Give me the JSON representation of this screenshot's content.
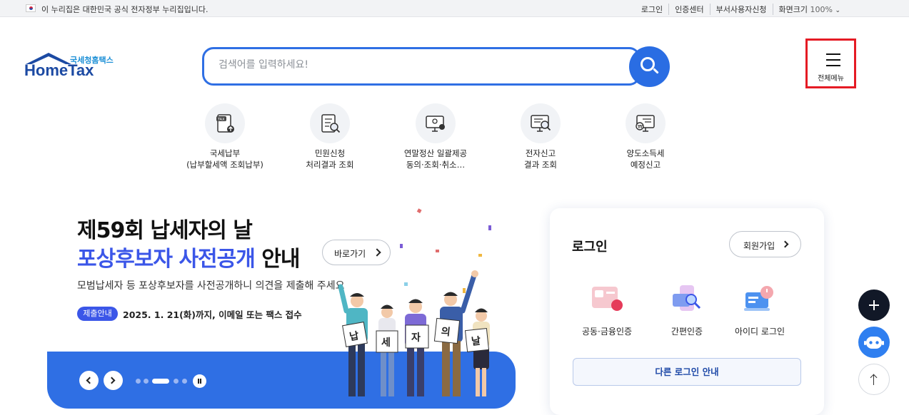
{
  "gov_bar": {
    "notice": "이 누리집은 대한민국 공식 전자정부 누리집입니다.",
    "links": [
      "로그인",
      "인증센터",
      "부서사용자신청"
    ],
    "zoom_label": "화면크기",
    "zoom_value": "100%"
  },
  "logo": {
    "sub": "국세청홈택스",
    "main": "HomeTax"
  },
  "search": {
    "placeholder": "검색어를 입력하세요!"
  },
  "full_menu": {
    "label": "전체메뉴"
  },
  "quick_menu": [
    {
      "line1": "국세납부",
      "line2": "(납부할세액 조회납부)",
      "icon": "tax-payment-icon"
    },
    {
      "line1": "민원신청",
      "line2": "처리결과 조회",
      "icon": "document-search-icon"
    },
    {
      "line1": "연말정산 일괄제공",
      "line2": "동의·조회·취소…",
      "icon": "monitor-settlement-icon"
    },
    {
      "line1": "전자신고",
      "line2": "결과 조회",
      "icon": "e-filing-search-icon"
    },
    {
      "line1": "양도소득세",
      "line2": "예정신고",
      "icon": "transfer-tax-icon"
    }
  ],
  "banner": {
    "title1": "제59회 납세자의 날",
    "title2_highlight": "포상후보자 사전공개",
    "title2_rest": " 안내",
    "go_label": "바로가기",
    "description": "모범납세자 등 포상후보자를 사전공개하니 의견을 제출해 주세요",
    "tag": "제출안내",
    "date_text": "2025. 1. 21(화)까지, 이메일 또는 팩스 접수",
    "sign_chars": [
      "납",
      "세",
      "자",
      "의",
      "날"
    ],
    "slide_count": 5,
    "active_slide": 3
  },
  "login": {
    "title": "로그인",
    "join_label": "회원가입",
    "methods": [
      {
        "label": "공동·금융인증",
        "icon": "certificate-icon"
      },
      {
        "label": "간편인증",
        "icon": "simple-auth-icon"
      },
      {
        "label": "아이디 로그인",
        "icon": "id-login-icon"
      }
    ],
    "other_label": "다른 로그인 안내"
  },
  "colors": {
    "brand_blue": "#2f6fe4",
    "accent_purple": "#3b56e8",
    "highlight_red": "#e51b24"
  }
}
